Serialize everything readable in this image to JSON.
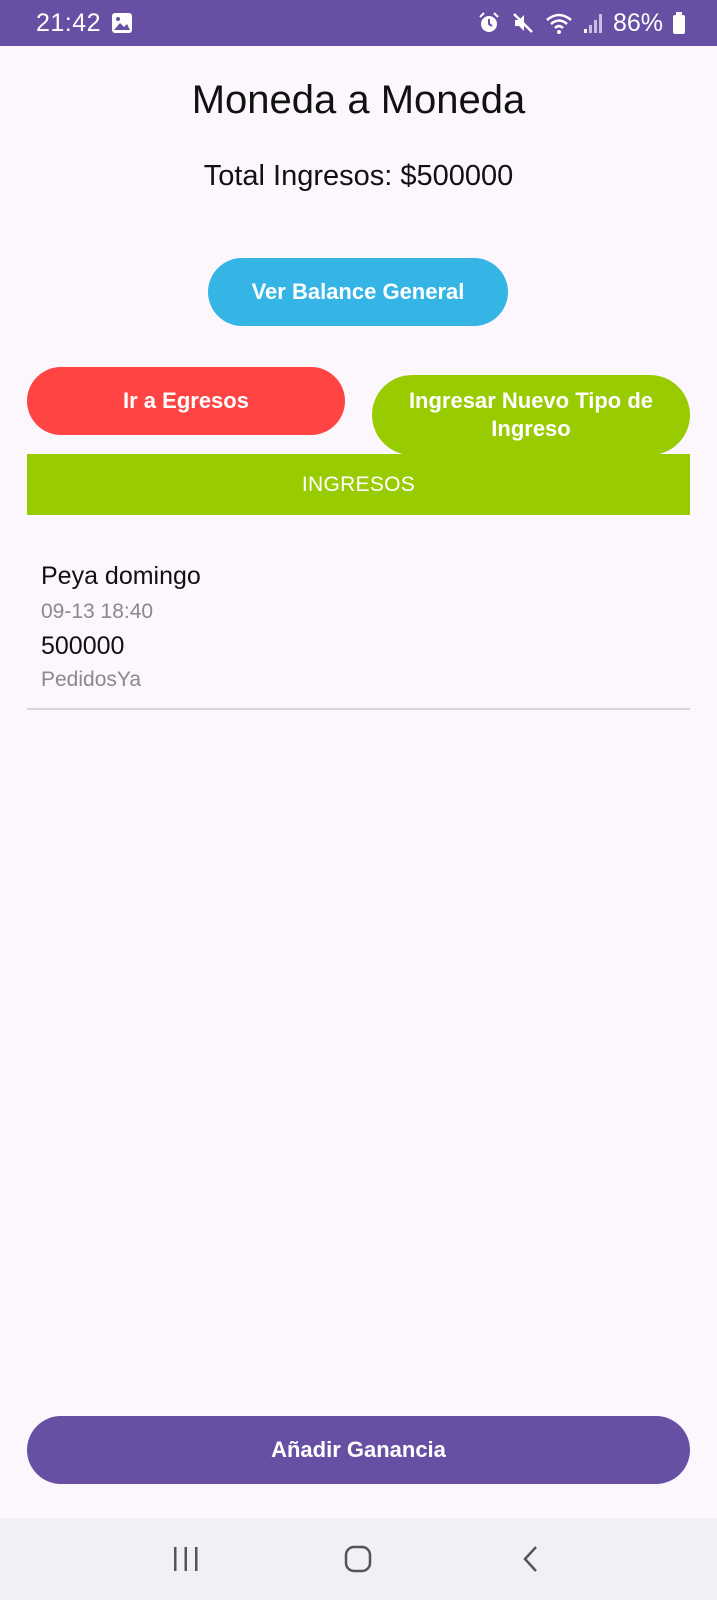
{
  "status_bar": {
    "time": "21:42",
    "battery": "86%",
    "icons": [
      "gallery-icon",
      "alarm-icon",
      "mute-icon",
      "wifi-icon",
      "signal-icon",
      "battery-icon"
    ]
  },
  "header": {
    "title": "Moneda a Moneda",
    "total": "Total Ingresos: $500000"
  },
  "actions": {
    "balance_label": "Ver Balance General",
    "egresos_label": "Ir a Egresos",
    "nuevo_tipo_label": "Ingresar Nuevo Tipo de Ingreso",
    "add_label": "Añadir Ganancia"
  },
  "list": {
    "header": "INGRESOS",
    "items": [
      {
        "name": "Peya domingo",
        "date": "09-13 18:40",
        "amount": "500000",
        "category": "PedidosYa"
      }
    ]
  },
  "colors": {
    "primary": "#6750a4",
    "balance": "#35b5e5",
    "egresos": "#ff4444",
    "ingresos": "#99cc00"
  },
  "nav": {
    "icons": [
      "recent-apps-icon",
      "home-icon",
      "back-icon"
    ]
  }
}
